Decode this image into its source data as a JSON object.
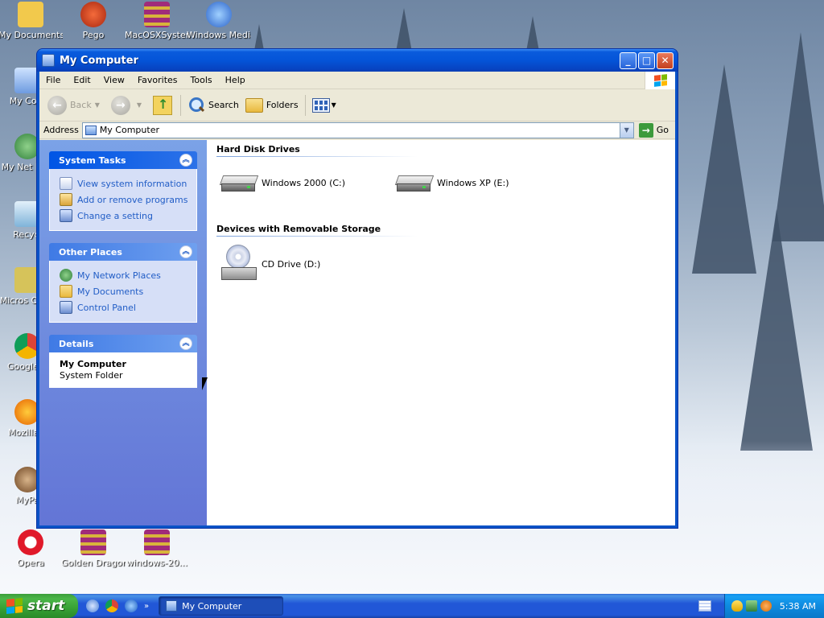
{
  "desktop": {
    "icons": [
      {
        "label": "My Documents",
        "icon": "my-documents-icon",
        "color": "#f2c94c"
      },
      {
        "label": "Pego",
        "icon": "pego-app-icon",
        "color": "#d6442b"
      },
      {
        "label": "MacOSXSystem",
        "icon": "winrar-archive-icon",
        "color": "#a02b7a"
      },
      {
        "label": "Windows Media Player",
        "icon": "windows-media-player-icon",
        "color": "#3a78d8"
      },
      {
        "label": "My Com",
        "icon": "my-computer-icon",
        "color": "#6d9be0"
      },
      {
        "label": "My Net Plac",
        "icon": "my-network-places-icon",
        "color": "#3fa04b"
      },
      {
        "label": "Recycl",
        "icon": "recycle-bin-icon",
        "color": "#7fb3d9"
      },
      {
        "label": "Micros Outlo",
        "icon": "outlook-icon",
        "color": "#d6c35a"
      },
      {
        "label": "Google C",
        "icon": "google-chrome-icon",
        "color": "#db4437"
      },
      {
        "label": "Mozilla F",
        "icon": "mozilla-firefox-icon",
        "color": "#e66000"
      },
      {
        "label": "MyPa",
        "icon": "mypa-icon",
        "color": "#8a5a2b"
      },
      {
        "label": "Opera",
        "icon": "opera-icon",
        "color": "#e0192a"
      },
      {
        "label": "Golden Dragon",
        "icon": "winrar-archive-icon",
        "color": "#a02b7a"
      },
      {
        "label": "windows-20...",
        "icon": "winrar-archive-icon",
        "color": "#a02b7a"
      }
    ]
  },
  "window": {
    "title": "My Computer",
    "menu": [
      "File",
      "Edit",
      "View",
      "Favorites",
      "Tools",
      "Help"
    ],
    "toolbar": {
      "back": "Back",
      "search": "Search",
      "folders": "Folders"
    },
    "address": {
      "label": "Address",
      "value": "My Computer",
      "go": "Go"
    },
    "task_pane": {
      "system_tasks": {
        "title": "System Tasks",
        "items": [
          "View system information",
          "Add or remove programs",
          "Change a setting"
        ]
      },
      "other_places": {
        "title": "Other Places",
        "items": [
          "My Network Places",
          "My Documents",
          "Control Panel"
        ]
      },
      "details": {
        "title": "Details",
        "name": "My Computer",
        "type": "System Folder"
      }
    },
    "content": {
      "hard_disk_drives": {
        "title": "Hard Disk Drives",
        "drives": [
          "Windows 2000 (C:)",
          "Windows XP (E:)"
        ]
      },
      "removable": {
        "title": "Devices with Removable Storage",
        "drives": [
          "CD Drive (D:)"
        ]
      }
    }
  },
  "taskbar": {
    "start": "start",
    "task_label": "My Computer",
    "clock": "5:38 AM",
    "more": "»"
  },
  "colors": {
    "xp_blue": "#0a53c7",
    "task_link": "#215dc6",
    "start_green": "#3c9e3a"
  }
}
